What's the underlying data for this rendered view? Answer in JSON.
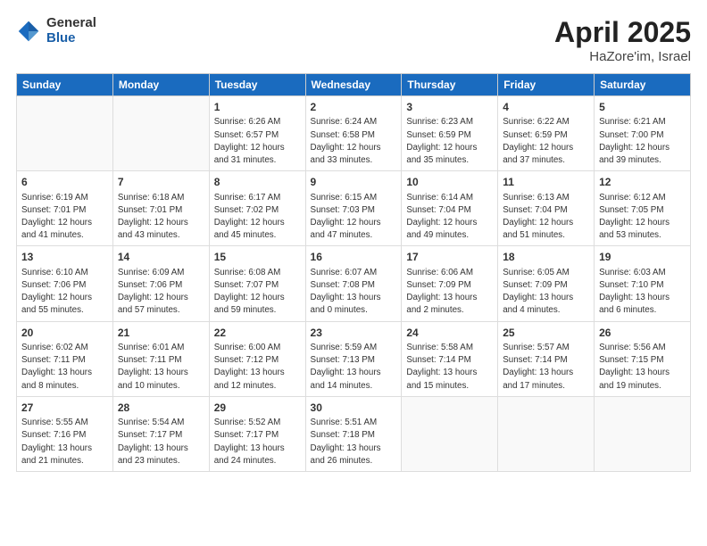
{
  "header": {
    "logo_general": "General",
    "logo_blue": "Blue",
    "title": "April 2025",
    "location": "HaZore'im, Israel"
  },
  "weekdays": [
    "Sunday",
    "Monday",
    "Tuesday",
    "Wednesday",
    "Thursday",
    "Friday",
    "Saturday"
  ],
  "weeks": [
    [
      {
        "day": "",
        "info": ""
      },
      {
        "day": "",
        "info": ""
      },
      {
        "day": "1",
        "info": "Sunrise: 6:26 AM\nSunset: 6:57 PM\nDaylight: 12 hours\nand 31 minutes."
      },
      {
        "day": "2",
        "info": "Sunrise: 6:24 AM\nSunset: 6:58 PM\nDaylight: 12 hours\nand 33 minutes."
      },
      {
        "day": "3",
        "info": "Sunrise: 6:23 AM\nSunset: 6:59 PM\nDaylight: 12 hours\nand 35 minutes."
      },
      {
        "day": "4",
        "info": "Sunrise: 6:22 AM\nSunset: 6:59 PM\nDaylight: 12 hours\nand 37 minutes."
      },
      {
        "day": "5",
        "info": "Sunrise: 6:21 AM\nSunset: 7:00 PM\nDaylight: 12 hours\nand 39 minutes."
      }
    ],
    [
      {
        "day": "6",
        "info": "Sunrise: 6:19 AM\nSunset: 7:01 PM\nDaylight: 12 hours\nand 41 minutes."
      },
      {
        "day": "7",
        "info": "Sunrise: 6:18 AM\nSunset: 7:01 PM\nDaylight: 12 hours\nand 43 minutes."
      },
      {
        "day": "8",
        "info": "Sunrise: 6:17 AM\nSunset: 7:02 PM\nDaylight: 12 hours\nand 45 minutes."
      },
      {
        "day": "9",
        "info": "Sunrise: 6:15 AM\nSunset: 7:03 PM\nDaylight: 12 hours\nand 47 minutes."
      },
      {
        "day": "10",
        "info": "Sunrise: 6:14 AM\nSunset: 7:04 PM\nDaylight: 12 hours\nand 49 minutes."
      },
      {
        "day": "11",
        "info": "Sunrise: 6:13 AM\nSunset: 7:04 PM\nDaylight: 12 hours\nand 51 minutes."
      },
      {
        "day": "12",
        "info": "Sunrise: 6:12 AM\nSunset: 7:05 PM\nDaylight: 12 hours\nand 53 minutes."
      }
    ],
    [
      {
        "day": "13",
        "info": "Sunrise: 6:10 AM\nSunset: 7:06 PM\nDaylight: 12 hours\nand 55 minutes."
      },
      {
        "day": "14",
        "info": "Sunrise: 6:09 AM\nSunset: 7:06 PM\nDaylight: 12 hours\nand 57 minutes."
      },
      {
        "day": "15",
        "info": "Sunrise: 6:08 AM\nSunset: 7:07 PM\nDaylight: 12 hours\nand 59 minutes."
      },
      {
        "day": "16",
        "info": "Sunrise: 6:07 AM\nSunset: 7:08 PM\nDaylight: 13 hours\nand 0 minutes."
      },
      {
        "day": "17",
        "info": "Sunrise: 6:06 AM\nSunset: 7:09 PM\nDaylight: 13 hours\nand 2 minutes."
      },
      {
        "day": "18",
        "info": "Sunrise: 6:05 AM\nSunset: 7:09 PM\nDaylight: 13 hours\nand 4 minutes."
      },
      {
        "day": "19",
        "info": "Sunrise: 6:03 AM\nSunset: 7:10 PM\nDaylight: 13 hours\nand 6 minutes."
      }
    ],
    [
      {
        "day": "20",
        "info": "Sunrise: 6:02 AM\nSunset: 7:11 PM\nDaylight: 13 hours\nand 8 minutes."
      },
      {
        "day": "21",
        "info": "Sunrise: 6:01 AM\nSunset: 7:11 PM\nDaylight: 13 hours\nand 10 minutes."
      },
      {
        "day": "22",
        "info": "Sunrise: 6:00 AM\nSunset: 7:12 PM\nDaylight: 13 hours\nand 12 minutes."
      },
      {
        "day": "23",
        "info": "Sunrise: 5:59 AM\nSunset: 7:13 PM\nDaylight: 13 hours\nand 14 minutes."
      },
      {
        "day": "24",
        "info": "Sunrise: 5:58 AM\nSunset: 7:14 PM\nDaylight: 13 hours\nand 15 minutes."
      },
      {
        "day": "25",
        "info": "Sunrise: 5:57 AM\nSunset: 7:14 PM\nDaylight: 13 hours\nand 17 minutes."
      },
      {
        "day": "26",
        "info": "Sunrise: 5:56 AM\nSunset: 7:15 PM\nDaylight: 13 hours\nand 19 minutes."
      }
    ],
    [
      {
        "day": "27",
        "info": "Sunrise: 5:55 AM\nSunset: 7:16 PM\nDaylight: 13 hours\nand 21 minutes."
      },
      {
        "day": "28",
        "info": "Sunrise: 5:54 AM\nSunset: 7:17 PM\nDaylight: 13 hours\nand 23 minutes."
      },
      {
        "day": "29",
        "info": "Sunrise: 5:52 AM\nSunset: 7:17 PM\nDaylight: 13 hours\nand 24 minutes."
      },
      {
        "day": "30",
        "info": "Sunrise: 5:51 AM\nSunset: 7:18 PM\nDaylight: 13 hours\nand 26 minutes."
      },
      {
        "day": "",
        "info": ""
      },
      {
        "day": "",
        "info": ""
      },
      {
        "day": "",
        "info": ""
      }
    ]
  ]
}
